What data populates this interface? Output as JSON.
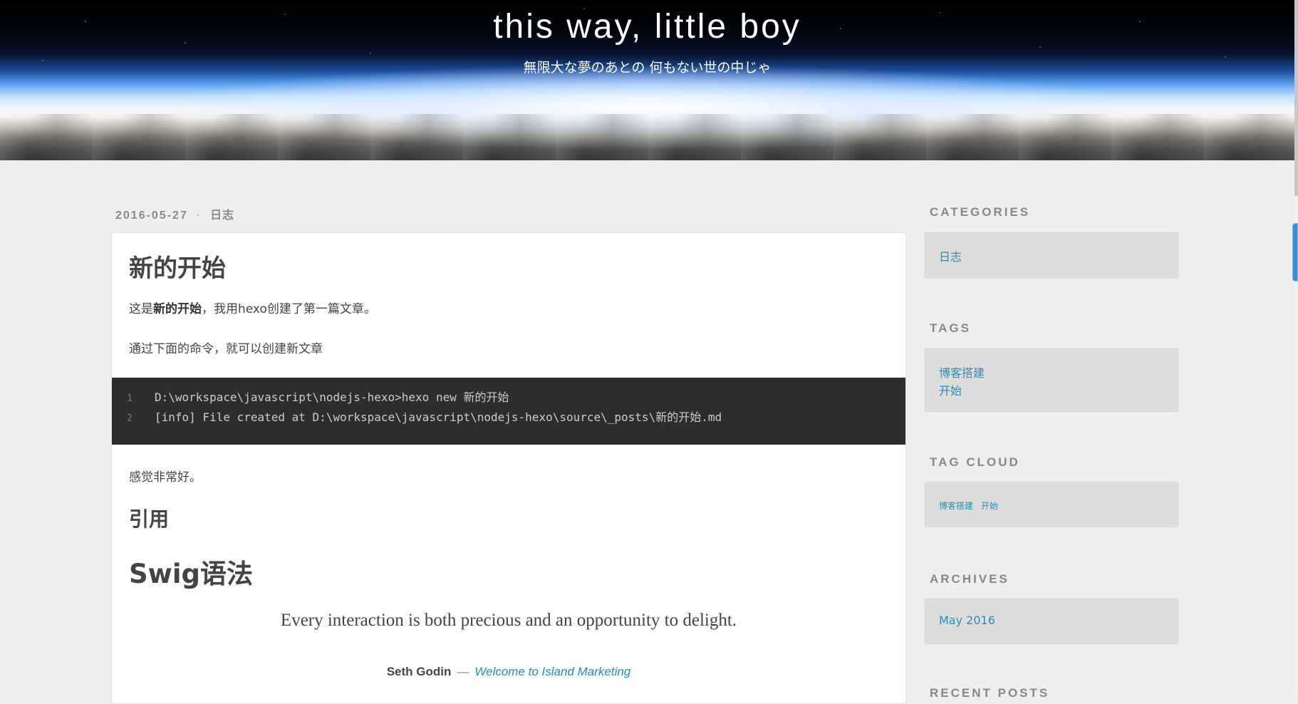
{
  "site": {
    "title": "this way, little boy",
    "subtitle": "無限大な夢のあとの 何もない世の中じゃ"
  },
  "post": {
    "date": "2016-05-27",
    "separator": "·",
    "category": "日志",
    "title": "新的开始",
    "p1_prefix": "这是",
    "p1_bold": "新的开始",
    "p1_suffix": "，我用hexo创建了第一篇文章。",
    "p2": "通过下面的命令，就可以创建新文章",
    "code": [
      {
        "n": "1",
        "text": "D:\\workspace\\javascript\\nodejs-hexo>hexo new 新的开始"
      },
      {
        "n": "2",
        "text": "[info] File created at D:\\workspace\\javascript\\nodejs-hexo\\source\\_posts\\新的开始.md"
      }
    ],
    "p3": "感觉非常好。",
    "h_quote": "引用",
    "h_swig": "Swig语法",
    "blockquote": "Every interaction is both precious and an opportunity to delight.",
    "cite_author": "Seth Godin",
    "cite_dash": "—",
    "cite_link": "Welcome to Island Marketing"
  },
  "sidebar": {
    "categories_title": "CATEGORIES",
    "categories": [
      "日志"
    ],
    "tags_title": "TAGS",
    "tags": [
      "博客搭建",
      "开始"
    ],
    "tagcloud_title": "TAG CLOUD",
    "tagcloud": [
      "博客搭建",
      "开始"
    ],
    "archives_title": "ARCHIVES",
    "archives": [
      "May 2016"
    ],
    "recent_title": "RECENT POSTS"
  },
  "colors": {
    "link": "#258fb8",
    "background": "#eeeeee",
    "code_bg": "#2d2d2d"
  }
}
